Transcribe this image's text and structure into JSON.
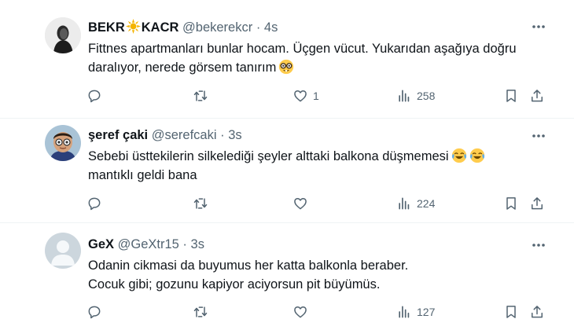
{
  "tweets": [
    {
      "name_part1": "BEKR",
      "name_part2": "KACR",
      "handle": "@bekerekcr",
      "dot": "·",
      "time": "4s",
      "text_line1": "Fittnes apartmanları bunlar hocam. Üçgen vücut. Yukarıdan aşağıya doğru",
      "text_line2": "daralıyor, nerede görsem tanırım",
      "replies": "",
      "retweets": "",
      "likes": "1",
      "views": "258"
    },
    {
      "name": "şeref çaki",
      "handle": "@serefcaki",
      "dot": "·",
      "time": "3s",
      "text_line1": "Sebebi üsttekilerin silkelediği şeyler alttaki balkona düşmemesi",
      "text_line2": "mantıklı geldi bana",
      "replies": "",
      "retweets": "",
      "likes": "",
      "views": "224"
    },
    {
      "name": "GeX",
      "handle": "@GeXtr15",
      "dot": "·",
      "time": "3s",
      "text_line1": "Odanin cikmasi da buyumus her katta balkonla beraber.",
      "text_line2": "Cocuk gibi; gozunu kapiyor aciyorsun pit büyümüs.",
      "replies": "",
      "retweets": "",
      "likes": "",
      "views": "127"
    }
  ],
  "colors": {
    "text": "#0f1419",
    "secondary": "#536471",
    "divider": "#eff3f4",
    "sun": "#f4b400"
  },
  "icons": [
    "sun-emoji-icon",
    "nerd-face-emoji-icon",
    "joy-emoji-icon",
    "more-icon",
    "reply-icon",
    "retweet-icon",
    "like-icon",
    "views-icon",
    "bookmark-icon",
    "share-icon"
  ]
}
